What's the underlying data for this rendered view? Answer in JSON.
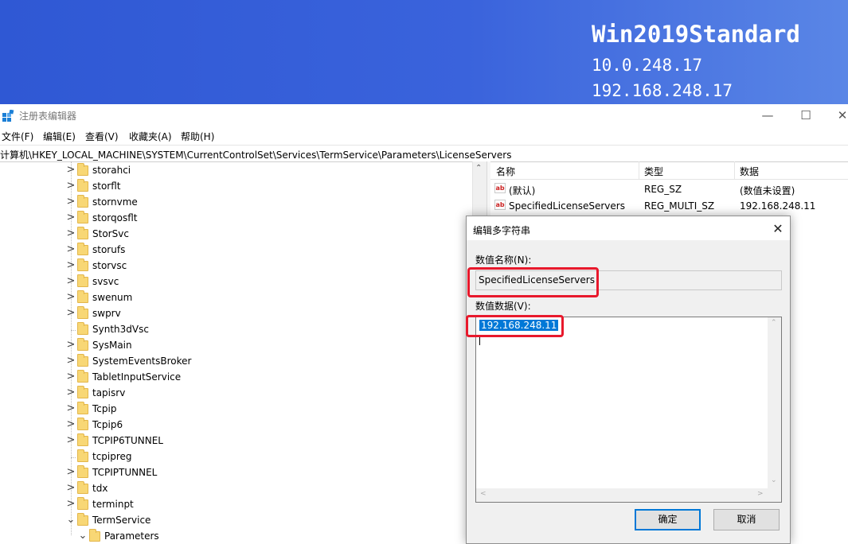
{
  "desktop": {
    "bginfo": {
      "hostname": "Win2019Standard",
      "ip1": "10.0.248.17",
      "ip2": "192.168.248.17"
    }
  },
  "window": {
    "title": "注册表编辑器",
    "app_icon": "registry-editor-icon",
    "controls": {
      "minimize": "—",
      "maximize": "☐",
      "close": "✕"
    },
    "menu": [
      "文件(F)",
      "编辑(E)",
      "查看(V)",
      "收藏夹(A)",
      "帮助(H)"
    ],
    "address": "计算机\\HKEY_LOCAL_MACHINE\\SYSTEM\\CurrentControlSet\\Services\\TermService\\Parameters\\LicenseServers"
  },
  "tree": {
    "items": [
      {
        "label": "storahci",
        "expander": ">"
      },
      {
        "label": "storflt",
        "expander": ">"
      },
      {
        "label": "stornvme",
        "expander": ">"
      },
      {
        "label": "storqosflt",
        "expander": ">"
      },
      {
        "label": "StorSvc",
        "expander": ">"
      },
      {
        "label": "storufs",
        "expander": ">"
      },
      {
        "label": "storvsc",
        "expander": ">"
      },
      {
        "label": "svsvc",
        "expander": ">"
      },
      {
        "label": "swenum",
        "expander": ">"
      },
      {
        "label": "swprv",
        "expander": ">"
      },
      {
        "label": "Synth3dVsc",
        "expander": ""
      },
      {
        "label": "SysMain",
        "expander": ">"
      },
      {
        "label": "SystemEventsBroker",
        "expander": ">"
      },
      {
        "label": "TabletInputService",
        "expander": ">"
      },
      {
        "label": "tapisrv",
        "expander": ">"
      },
      {
        "label": "Tcpip",
        "expander": ">"
      },
      {
        "label": "Tcpip6",
        "expander": ">"
      },
      {
        "label": "TCPIP6TUNNEL",
        "expander": ">"
      },
      {
        "label": "tcpipreg",
        "expander": ""
      },
      {
        "label": "TCPIPTUNNEL",
        "expander": ">"
      },
      {
        "label": "tdx",
        "expander": ">"
      },
      {
        "label": "terminpt",
        "expander": ">"
      },
      {
        "label": "TermService",
        "expander": "⌄"
      },
      {
        "label": "Parameters",
        "expander": "⌄"
      }
    ]
  },
  "values": {
    "headers": [
      "名称",
      "类型",
      "数据"
    ],
    "rows": [
      {
        "name": "(默认)",
        "type": "REG_SZ",
        "data": "(数值未设置)",
        "icon": "string-value-icon"
      },
      {
        "name": "SpecifiedLicenseServers",
        "type": "REG_MULTI_SZ",
        "data": "192.168.248.11",
        "icon": "string-value-icon"
      }
    ]
  },
  "dialog": {
    "title": "编辑多字符串",
    "close": "✕",
    "name_label": "数值名称(N):",
    "name_value": "SpecifiedLicenseServers",
    "data_label": "数值数据(V):",
    "data_value": "192.168.248.11",
    "ok": "确定",
    "cancel": "取消"
  },
  "colors": {
    "highlight_box": "#e8192c",
    "selection": "#0078d7",
    "desktop": "#3a63dc"
  }
}
